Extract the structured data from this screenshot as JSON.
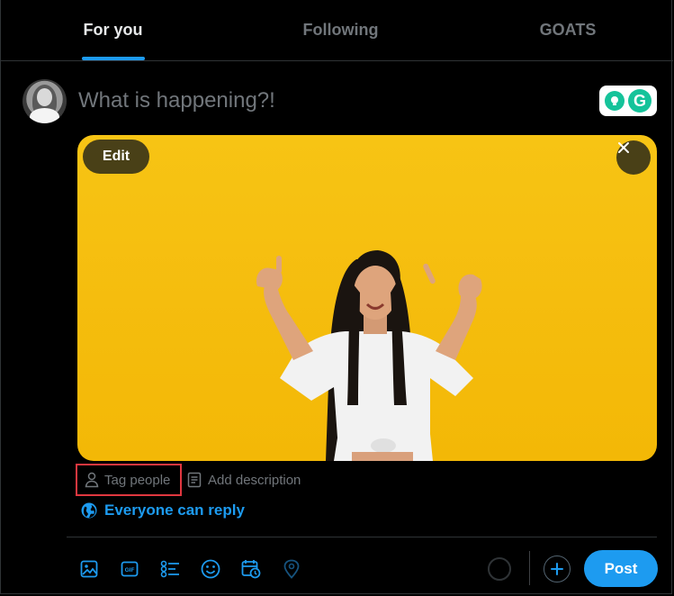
{
  "tabs": [
    {
      "label": "For you",
      "active": true
    },
    {
      "label": "Following",
      "active": false
    },
    {
      "label": "GOATS",
      "active": false
    }
  ],
  "composer": {
    "placeholder": "What is happening?!",
    "grammarly_letter": "G"
  },
  "media": {
    "edit_label": "Edit",
    "close_icon": "close-icon",
    "background_color": "#f5bd0e"
  },
  "media_actions": {
    "tag_people": "Tag people",
    "add_description": "Add description"
  },
  "reply_setting": "Everyone can reply",
  "toolbar": {
    "icons": [
      "media-icon",
      "gif-icon",
      "poll-icon",
      "emoji-icon",
      "schedule-icon",
      "location-icon"
    ],
    "gif_text": "GIF",
    "post_label": "Post"
  },
  "colors": {
    "accent": "#1d9bf0",
    "highlight_border": "#e0373f",
    "muted": "#71767b"
  }
}
